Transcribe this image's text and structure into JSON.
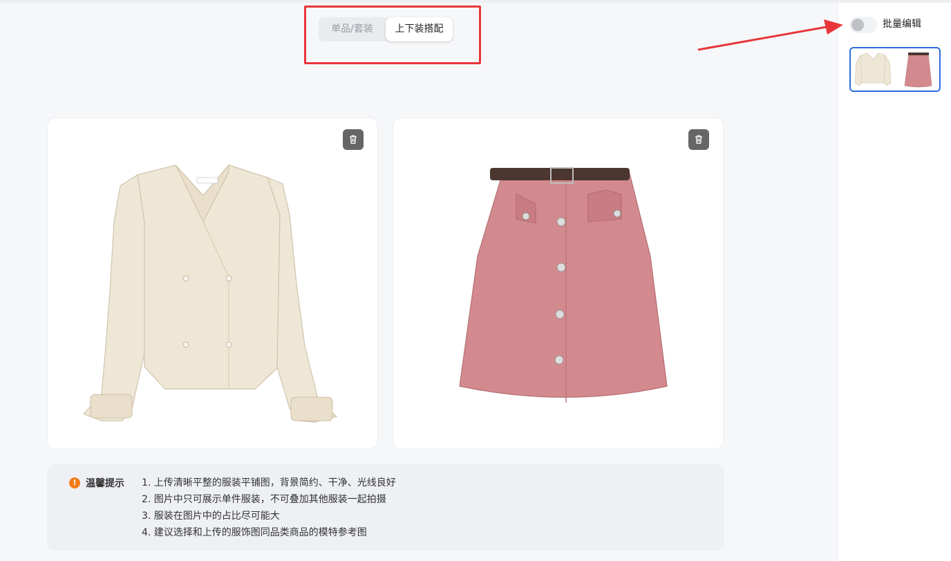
{
  "mode_tabs": {
    "single": "单品/套装",
    "combo": "上下装搭配",
    "active": "combo"
  },
  "garments": [
    {
      "name": "blouse",
      "kind": "top"
    },
    {
      "name": "skirt",
      "kind": "bottom"
    }
  ],
  "tips": {
    "title": "温馨提示",
    "items": [
      "1. 上传清晰平整的服装平铺图，背景简约、干净、光线良好",
      "2. 图片中只可展示单件服装，不可叠加其他服装一起拍摄",
      "3. 服装在图片中的占比尽可能大",
      "4. 建议选择和上传的服饰图同品类商品的模特参考图"
    ]
  },
  "side_panel": {
    "batch_edit_label": "批量编辑",
    "batch_edit_on": false
  },
  "colors": {
    "accent_blue": "#2f6be0",
    "annotation_red": "#e8363a",
    "tip_orange": "#f47c1a"
  },
  "icons": {
    "delete": "trash-icon",
    "tip": "exclamation-icon"
  }
}
